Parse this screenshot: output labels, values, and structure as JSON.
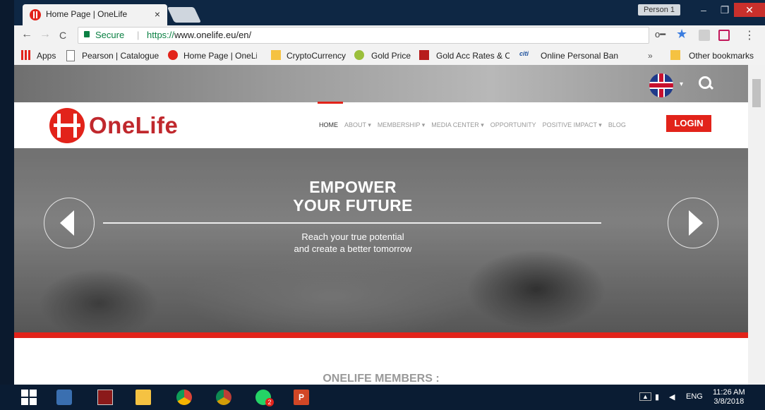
{
  "tab": {
    "title": "Home Page | OneLife",
    "close": "×"
  },
  "profile": {
    "name": "Person 1"
  },
  "window": {
    "minimize": "–",
    "maximize": "❐",
    "close": "✕"
  },
  "toolbar": {
    "back": "←",
    "forward": "→",
    "reload": "C",
    "secure_label": "Secure",
    "url_scheme": "https://",
    "url_rest": "www.onelife.eu/en/",
    "menu": "⋮"
  },
  "bookmarks": {
    "apps": "Apps",
    "items": [
      "Pearson | Catalogue",
      "Home Page | OneLife",
      "CryptoCurrency",
      "Gold Price",
      "Gold Acc Rates & Ch",
      "Online Personal Bank"
    ],
    "more": "»",
    "other": "Other bookmarks"
  },
  "site": {
    "logo": "OneLife",
    "nav": [
      "HOME",
      "ABOUT ▾",
      "MEMBERSHIP ▾",
      "MEDIA CENTER ▾",
      "OPPORTUNITY",
      "POSITIVE IMPACT ▾",
      "BLOG"
    ],
    "login": "LOGIN",
    "hero_title_1": "EMPOWER",
    "hero_title_2": "YOUR FUTURE",
    "hero_sub_1": "Reach your true potential",
    "hero_sub_2": "and create a better tomorrow",
    "members_heading": "ONELIFE MEMBERS :",
    "flag_caret": "▾"
  },
  "taskbar": {
    "lang": "ENG",
    "time": "11:26 AM",
    "date": "3/8/2018",
    "whatsapp_badge": "2"
  },
  "colors": {
    "brand_red": "#e2231a",
    "taskbar": "#0a1c33"
  }
}
